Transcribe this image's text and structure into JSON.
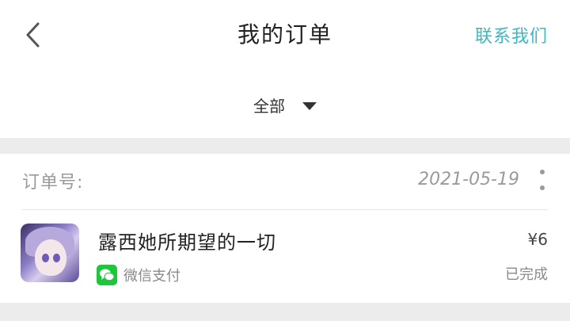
{
  "header": {
    "title": "我的订单",
    "contact_label": "联系我们",
    "back_icon": "chevron-left-icon"
  },
  "filter": {
    "label": "全部",
    "icon": "caret-down-icon"
  },
  "order": {
    "order_no_label": "订单号:",
    "date": "2021-05-19",
    "product_name": "露西她所期望的一切",
    "payment_method": "微信支付",
    "price": "¥6",
    "status": "已完成"
  },
  "colors": {
    "accent": "#3ab8c4",
    "wechat_green": "#1dc63a",
    "muted_text": "#9a9a9a",
    "background": "#ececec"
  }
}
